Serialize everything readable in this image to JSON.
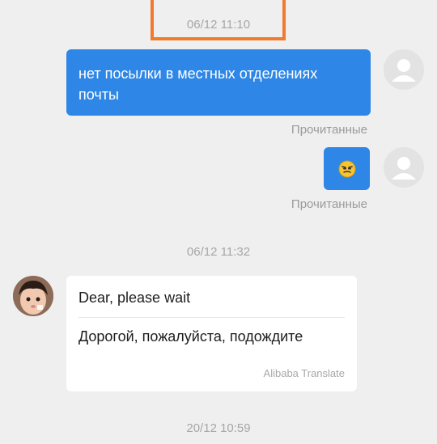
{
  "conversation": {
    "timestamp_1": "06/12 11:10",
    "outgoing_message_text": "нет посылки в местных отделениях почты",
    "read_status_1": "Прочитанные",
    "emoji_message_icon": "smirk-emoji-icon",
    "read_status_2": "Прочитанные",
    "timestamp_2": "06/12 11:32",
    "incoming_original_text": "Dear, please wait",
    "incoming_translated_text": "Дорогой, пожалуйста, подождите",
    "translation_credit": "Alibaba Translate",
    "timestamp_3": "20/12 10:59"
  },
  "colors": {
    "background": "#efefef",
    "outgoing_bubble": "#2e87e6",
    "incoming_bubble": "#ffffff",
    "highlight_box": "#f07a2e",
    "timestamp_text": "#a6a6a6"
  }
}
